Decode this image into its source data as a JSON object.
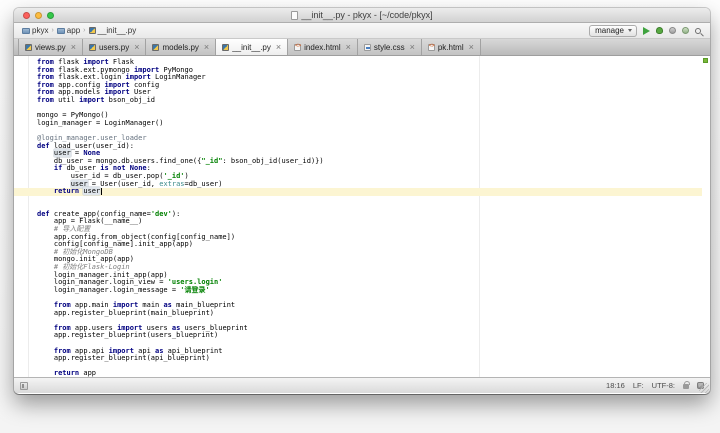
{
  "window": {
    "title": "__init__.py - pkyx - [~/code/pkyx]"
  },
  "breadcrumbs": [
    {
      "label": "pkyx",
      "icon": "folder"
    },
    {
      "label": "app",
      "icon": "folder"
    },
    {
      "label": "__init__.py",
      "icon": "python-file"
    }
  ],
  "toolbar": {
    "run_config": "manage"
  },
  "tabs": [
    {
      "label": "views.py",
      "kind": "py",
      "active": false
    },
    {
      "label": "users.py",
      "kind": "py",
      "active": false
    },
    {
      "label": "models.py",
      "kind": "py",
      "active": false
    },
    {
      "label": "__init__.py",
      "kind": "py",
      "active": true
    },
    {
      "label": "index.html",
      "kind": "html",
      "active": false
    },
    {
      "label": "style.css",
      "kind": "css",
      "active": false
    },
    {
      "label": "pk.html",
      "kind": "html",
      "active": false
    }
  ],
  "editor": {
    "caret_line": 18,
    "lines": [
      [
        [
          "k",
          "from"
        ],
        [
          "t",
          " flask "
        ],
        [
          "k",
          "import"
        ],
        [
          "t",
          " Flask"
        ]
      ],
      [
        [
          "k",
          "from"
        ],
        [
          "t",
          " flask.ext.pymongo "
        ],
        [
          "k",
          "import"
        ],
        [
          "t",
          " PyMongo"
        ]
      ],
      [
        [
          "k",
          "from"
        ],
        [
          "t",
          " flask.ext.login "
        ],
        [
          "k",
          "import"
        ],
        [
          "t",
          " LoginManager"
        ]
      ],
      [
        [
          "k",
          "from"
        ],
        [
          "t",
          " app.config "
        ],
        [
          "k",
          "import"
        ],
        [
          "t",
          " config"
        ]
      ],
      [
        [
          "k",
          "from"
        ],
        [
          "t",
          " app.models "
        ],
        [
          "k",
          "import"
        ],
        [
          "t",
          " User"
        ]
      ],
      [
        [
          "k",
          "from"
        ],
        [
          "t",
          " util "
        ],
        [
          "k",
          "import"
        ],
        [
          "t",
          " bson_obj_id"
        ]
      ],
      [],
      [
        [
          "t",
          "mongo = PyMongo()"
        ]
      ],
      [
        [
          "t",
          "login_manager = LoginManager()"
        ]
      ],
      [],
      [
        [
          "d",
          "@login_manager.user_loader"
        ]
      ],
      [
        [
          "k",
          "def"
        ],
        [
          "t",
          " load_user(user_id):"
        ]
      ],
      [
        [
          "t",
          "    "
        ],
        [
          "hl",
          "user"
        ],
        [
          "t",
          " = "
        ],
        [
          "k",
          "None"
        ]
      ],
      [
        [
          "t",
          "    db_user = mongo.db.users.find_one({"
        ],
        [
          "s",
          "\"_id\""
        ],
        [
          "t",
          ": bson_obj_id(user_id)})"
        ]
      ],
      [
        [
          "t",
          "    "
        ],
        [
          "k",
          "if"
        ],
        [
          "t",
          " db_user "
        ],
        [
          "k",
          "is"
        ],
        [
          "t",
          " "
        ],
        [
          "k",
          "not"
        ],
        [
          "t",
          " "
        ],
        [
          "k",
          "None"
        ],
        [
          "t",
          ":"
        ]
      ],
      [
        [
          "t",
          "        user_id = db_user.pop("
        ],
        [
          "s",
          "'_id'"
        ],
        [
          "t",
          ")"
        ]
      ],
      [
        [
          "t",
          "        "
        ],
        [
          "hl",
          "user"
        ],
        [
          "t",
          " = User(user_id, "
        ],
        [
          "kw",
          "extras"
        ],
        [
          "t",
          "=db_user)"
        ]
      ],
      [
        [
          "t",
          "    "
        ],
        [
          "k",
          "return"
        ],
        [
          "t",
          " "
        ],
        [
          "hl",
          "user"
        ]
      ],
      [],
      [],
      [
        [
          "k",
          "def"
        ],
        [
          "t",
          " create_app(config_name="
        ],
        [
          "s",
          "'dev'"
        ],
        [
          "t",
          "):"
        ]
      ],
      [
        [
          "t",
          "    app = Flask(__name__)"
        ]
      ],
      [
        [
          "c",
          "    # 导入配置"
        ]
      ],
      [
        [
          "t",
          "    app.config.from_object(config[config_name])"
        ]
      ],
      [
        [
          "t",
          "    config[config_name].init_app(app)"
        ]
      ],
      [
        [
          "c",
          "    # 初始化MongoDB"
        ]
      ],
      [
        [
          "t",
          "    mongo.init_app(app)"
        ]
      ],
      [
        [
          "c",
          "    # 初始化Flask-Login"
        ]
      ],
      [
        [
          "t",
          "    login_manager.init_app(app)"
        ]
      ],
      [
        [
          "t",
          "    login_manager.login_view = "
        ],
        [
          "s",
          "'users.login'"
        ]
      ],
      [
        [
          "t",
          "    login_manager.login_message = "
        ],
        [
          "s",
          "'请登录'"
        ]
      ],
      [],
      [
        [
          "t",
          "    "
        ],
        [
          "k",
          "from"
        ],
        [
          "t",
          " app.main "
        ],
        [
          "k",
          "import"
        ],
        [
          "t",
          " main "
        ],
        [
          "k",
          "as"
        ],
        [
          "t",
          " main_blueprint"
        ]
      ],
      [
        [
          "t",
          "    app.register_blueprint(main_blueprint)"
        ]
      ],
      [],
      [
        [
          "t",
          "    "
        ],
        [
          "k",
          "from"
        ],
        [
          "t",
          " app.users "
        ],
        [
          "k",
          "import"
        ],
        [
          "t",
          " users "
        ],
        [
          "k",
          "as"
        ],
        [
          "t",
          " users_blueprint"
        ]
      ],
      [
        [
          "t",
          "    app.register_blueprint(users_blueprint)"
        ]
      ],
      [],
      [
        [
          "t",
          "    "
        ],
        [
          "k",
          "from"
        ],
        [
          "t",
          " app.api "
        ],
        [
          "k",
          "import"
        ],
        [
          "t",
          " api "
        ],
        [
          "k",
          "as"
        ],
        [
          "t",
          " api_blueprint"
        ]
      ],
      [
        [
          "t",
          "    app.register_blueprint(api_blueprint)"
        ]
      ],
      [],
      [
        [
          "t",
          "    "
        ],
        [
          "k",
          "return"
        ],
        [
          "t",
          " app"
        ]
      ]
    ]
  },
  "statusbar": {
    "position": "18:16",
    "line_ending": "LF:",
    "encoding": "UTF-8:"
  },
  "colors": {
    "keyword": "#000080",
    "string": "#008000",
    "comment": "#808080",
    "decorator": "#64707e",
    "caret_line_bg": "#fcf5d2",
    "run_green": "#3fa33f",
    "inspection_ok": "#7ab839"
  }
}
